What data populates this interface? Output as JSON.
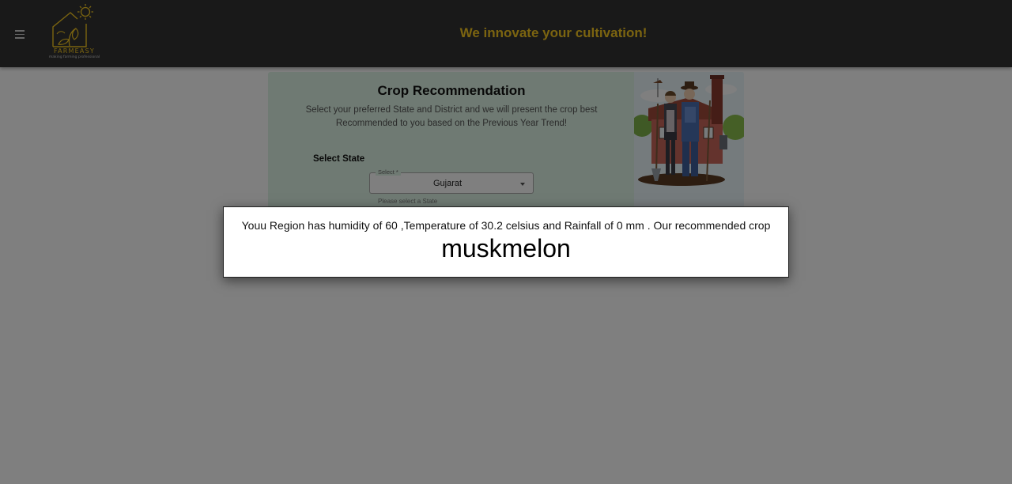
{
  "header": {
    "menu_icon": "menu-icon",
    "logo": {
      "brand": "FARMEASY",
      "tagline": "making farming professional"
    },
    "slogan": "We innovate your cultivation!"
  },
  "card": {
    "title": "Crop Recommendation",
    "description": "Select your preferred State and District and we will present the crop best Recommended to you based on the Previous Year Trend!",
    "state_label": "Select State",
    "state_select": {
      "caption": "Select *",
      "value": "Gujarat",
      "helper": "Please select a State"
    }
  },
  "dialog": {
    "message": "Youu Region has humidity of 60 ,Temperature of 30.2 celsius and Rainfall of 0 mm . Our recommended crop",
    "crop": "muskmelon"
  },
  "colors": {
    "header_bg": "#333333",
    "accent": "#f6c821",
    "card_bg": "#dff5e6"
  }
}
